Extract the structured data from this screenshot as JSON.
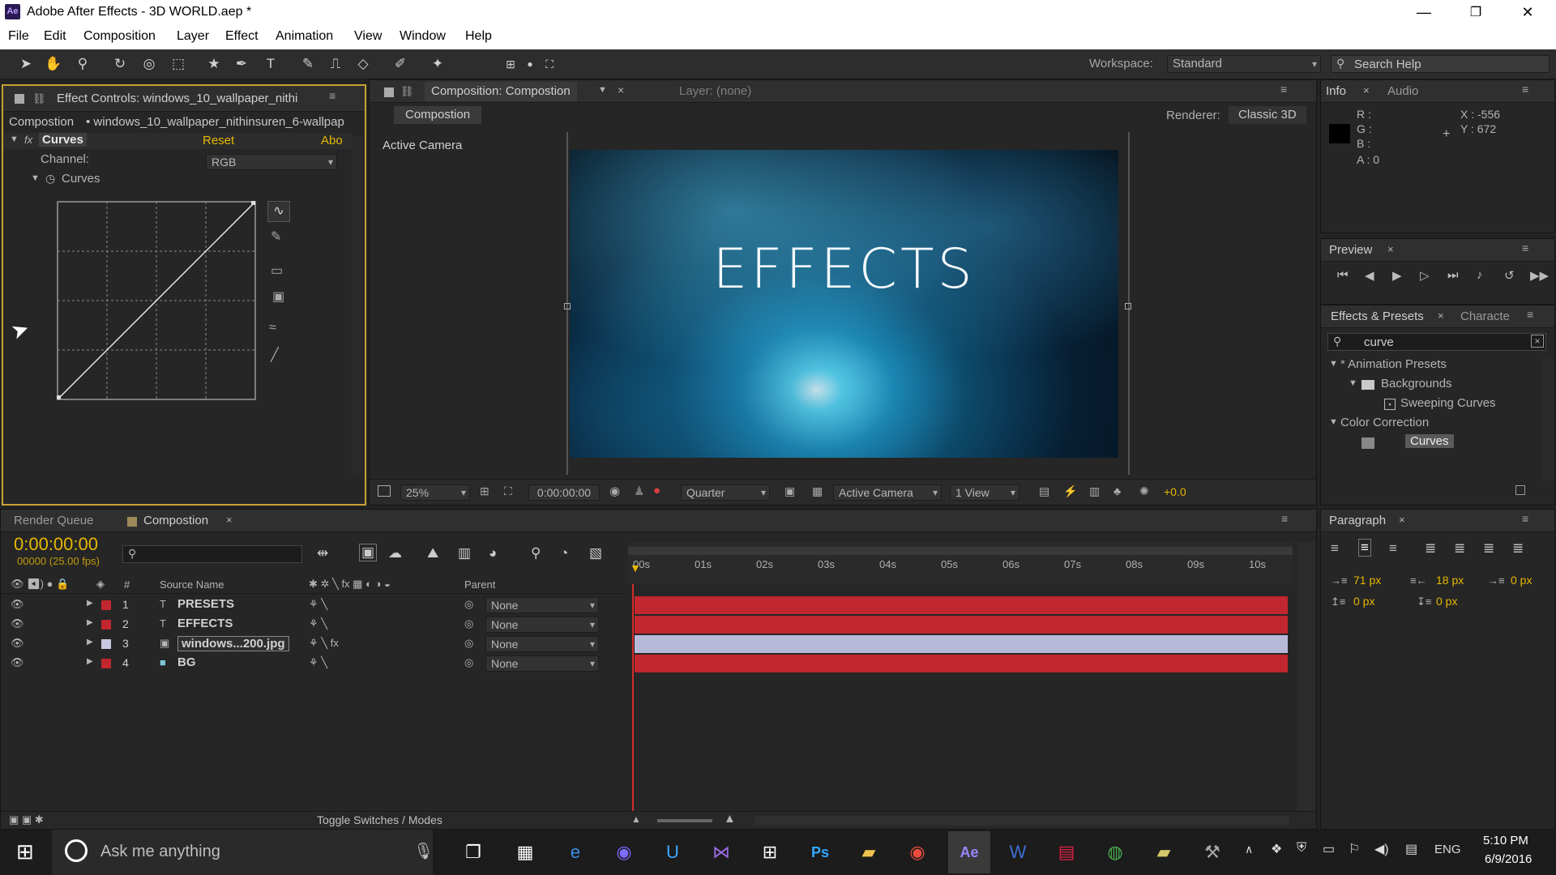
{
  "window": {
    "title": "Adobe After Effects - 3D WORLD.aep *",
    "logo": "Ae"
  },
  "menu": [
    "File",
    "Edit",
    "Composition",
    "Layer",
    "Effect",
    "Animation",
    "View",
    "Window",
    "Help"
  ],
  "toolbar": {
    "workspace_label": "Workspace:",
    "workspace_value": "Standard",
    "search_placeholder": "Search Help"
  },
  "effect_controls": {
    "tab": "Effect Controls: windows_10_wallpaper_nithi",
    "breadcrumb_comp": "Compostion",
    "breadcrumb_layer": "• windows_10_wallpaper_nithinsuren_6-wallpap",
    "effect_name": "Curves",
    "reset": "Reset",
    "about": "Abo",
    "channel_label": "Channel:",
    "channel_value": "RGB",
    "curves_label": "Curves"
  },
  "composition": {
    "tab": "Composition: Compostion",
    "layer_tab": "Layer: (none)",
    "sub_tab": "Compostion",
    "renderer_label": "Renderer:",
    "renderer_value": "Classic 3D",
    "camera_label": "Active Camera",
    "overlay_text": "EFFECTS",
    "footer": {
      "zoom": "25%",
      "time": "0:00:00:00",
      "resolution": "Quarter",
      "camera": "Active Camera",
      "views": "1 View",
      "exposure": "+0.0"
    }
  },
  "info": {
    "tab": "Info",
    "tab2": "Audio",
    "r": "R :",
    "g": "G :",
    "b": "B :",
    "a": "A : 0",
    "x": "X : -556",
    "y": "Y : 672"
  },
  "preview": {
    "tab": "Preview"
  },
  "effects_presets": {
    "tab": "Effects & Presets",
    "tab2": "Characte",
    "search": "curve",
    "tree": [
      {
        "label": "* Animation Presets"
      },
      {
        "label": "Backgrounds"
      },
      {
        "label": "Sweeping Curves"
      },
      {
        "label": "Color Correction"
      },
      {
        "label": "Curves"
      }
    ]
  },
  "timeline": {
    "tab_render": "Render Queue",
    "tab_comp": "Compostion",
    "timecode": "0:00:00:00",
    "fps": "00000 (25.00 fps)",
    "col_num": "#",
    "col_source": "Source Name",
    "col_parent": "Parent",
    "ruler": [
      "00s",
      "01s",
      "02s",
      "03s",
      "04s",
      "05s",
      "06s",
      "07s",
      "08s",
      "09s",
      "10s"
    ],
    "layers": [
      {
        "num": "1",
        "name": "PRESETS",
        "parent": "None",
        "color": "#c2262e"
      },
      {
        "num": "2",
        "name": "EFFECTS",
        "parent": "None",
        "color": "#c2262e"
      },
      {
        "num": "3",
        "name": "windows...200.jpg",
        "parent": "None",
        "color": "#b8b8d8"
      },
      {
        "num": "4",
        "name": "BG",
        "parent": "None",
        "color": "#c2262e"
      }
    ],
    "toggle_label": "Toggle Switches / Modes"
  },
  "paragraph": {
    "tab": "Paragraph",
    "indent_left": "71 px",
    "indent_right": "18 px",
    "indent_first": "0 px",
    "space_before": "0 px",
    "space_after": "0 px"
  },
  "taskbar": {
    "search": "Ask me anything",
    "lang": "ENG",
    "time": "5:10 PM",
    "date": "6/9/2016"
  }
}
